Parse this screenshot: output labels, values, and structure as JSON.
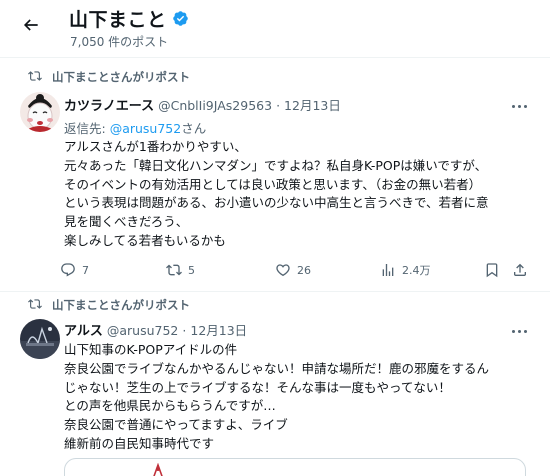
{
  "header": {
    "title": "山下まこと",
    "post_count": "7,050 件のポスト"
  },
  "posts": [
    {
      "repost_label": "山下まことさんがリポスト",
      "author": "カツラノエース",
      "handle": "@CnblIi9JAs29563",
      "separator": "·",
      "date": "12月13日",
      "reply_prefix": "返信先:",
      "reply_to": "@arusu752",
      "reply_suffix": "さん",
      "lines": [
        "アルスさんが1番わかりやすい、",
        "元々あった「韓日文化ハンマダン」ですよね？私自身K-POPは嫌いですが、",
        "そのイベントの有効活用としては良い政策と思います、（お金の無い若者）",
        "という表現は問題がある、お小遣いの少ない中高生と言うべきで、若者に意",
        "見を聞くべきだろう、",
        "楽しみしてる若者もいるかも"
      ],
      "stats": {
        "replies": "7",
        "reposts": "5",
        "likes": "26",
        "views": "2.4万"
      }
    },
    {
      "repost_label": "山下まことさんがリポスト",
      "author": "アルス",
      "handle": "@arusu752",
      "separator": "·",
      "date": "12月13日",
      "lines": [
        "山下知事のK-POPアイドルの件",
        "奈良公園でライブなんかやるんじゃない！申請な場所だ！鹿の邪魔をするん",
        "じゃない！芝生の上でライブするな！そんな事は一度もやってない！",
        "との声を他県民からもらうんですが…",
        "奈良公園で普通にやってますよ、ライブ",
        "維新前の自民知事時代です"
      ]
    }
  ],
  "colors": {
    "accent": "#1d9bf0",
    "secondary_text": "#536471",
    "border": "#eff3f4"
  },
  "icons": [
    "back-arrow-icon",
    "verified-badge-icon",
    "repost-icon",
    "more-icon",
    "reply-icon",
    "like-icon",
    "views-icon",
    "bookmark-icon",
    "share-icon"
  ]
}
